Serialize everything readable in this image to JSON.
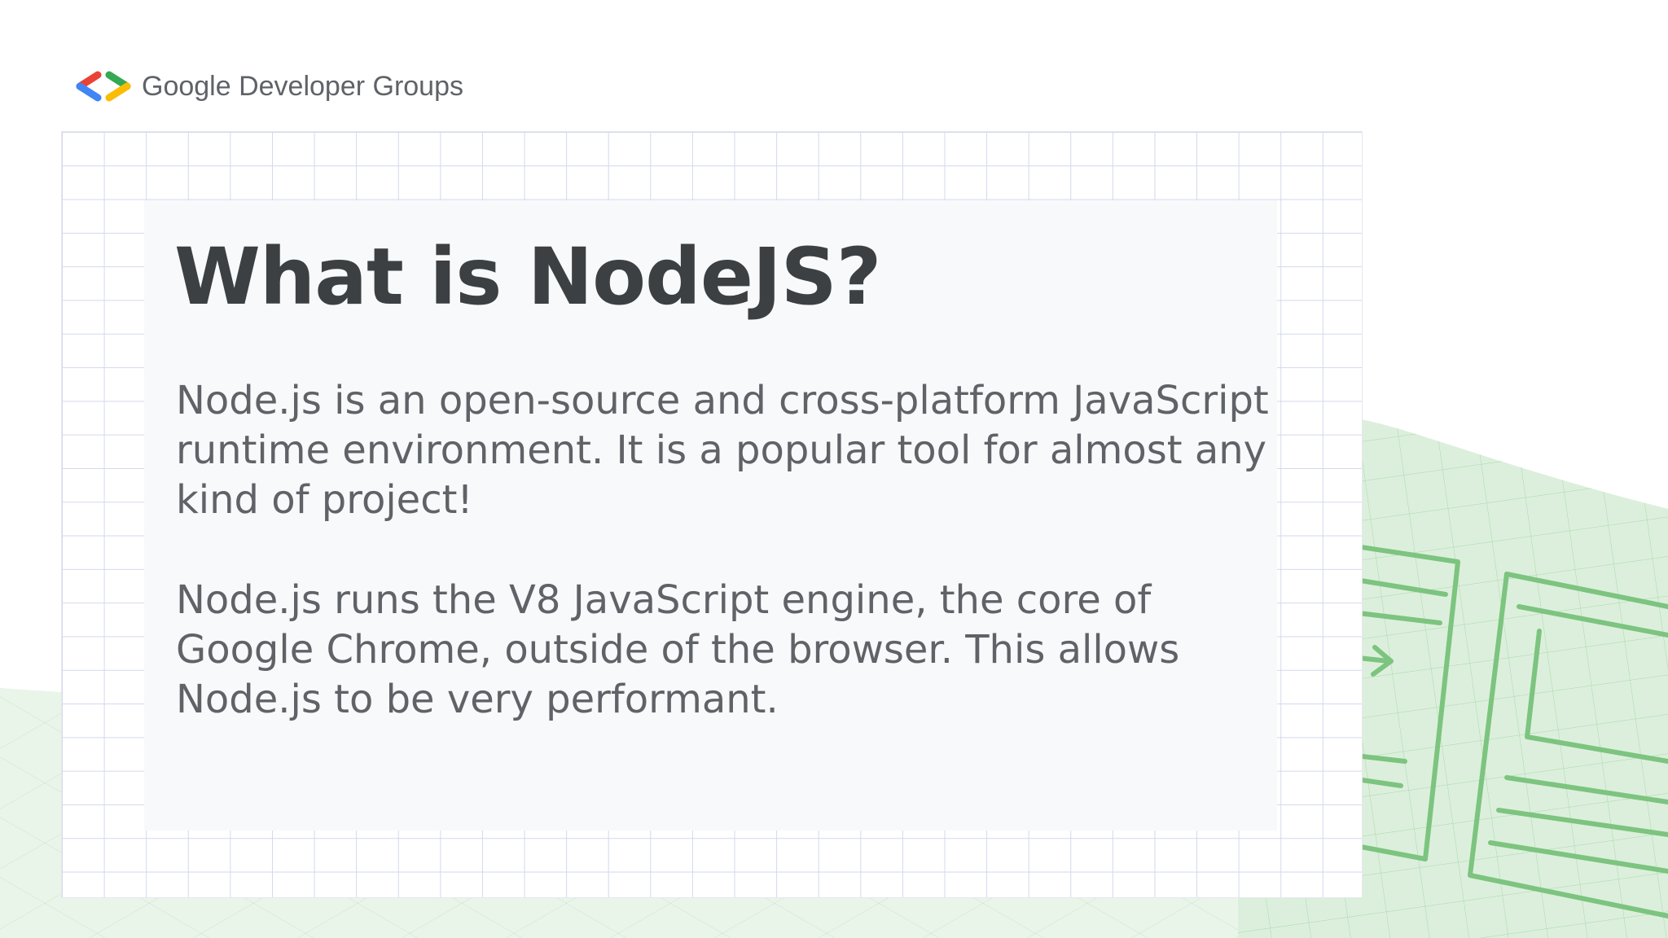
{
  "logo": {
    "text": "Google Developer Groups"
  },
  "slide": {
    "title": "What is NodeJS?",
    "paragraphs": [
      "Node.js is an open-source and cross-platform JavaScript runtime environment. It is a popular tool for almost any kind of project!",
      "Node.js runs the V8 JavaScript engine, the core of Google Chrome, outside of the browser. This allows Node.js to be very performant."
    ]
  },
  "colors": {
    "title": "#3c4043",
    "body": "#5f6368",
    "grid": "#d3d9ec",
    "inner_panel": "#f8f9fa",
    "decor_green": "#7cc47f",
    "decor_green_bg": "#e3f3e3",
    "logo_red": "#ea4335",
    "logo_blue": "#4285f4",
    "logo_green": "#34a853",
    "logo_yellow": "#fbbc04"
  }
}
